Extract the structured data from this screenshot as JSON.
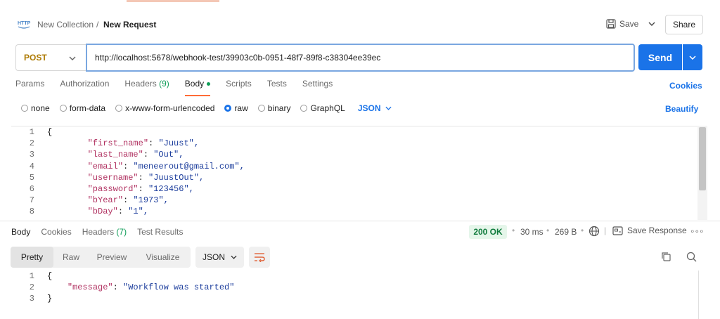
{
  "header": {
    "breadcrumb_parent": "New Collection",
    "breadcrumb_sep": "/",
    "breadcrumb_current": "New Request",
    "save_label": "Save",
    "share_label": "Share"
  },
  "request": {
    "method": "POST",
    "url": "http://localhost:5678/webhook-test/39903c0b-0951-48f7-89f8-c38304ee39ec",
    "send_label": "Send",
    "method_color": "#ad7a03"
  },
  "tabs": {
    "params": "Params",
    "authorization": "Authorization",
    "headers": "Headers",
    "headers_count": "(9)",
    "body": "Body",
    "scripts": "Scripts",
    "tests": "Tests",
    "settings": "Settings",
    "cookies": "Cookies"
  },
  "body_types": {
    "none": "none",
    "form_data": "form-data",
    "urlencoded": "x-www-form-urlencoded",
    "raw": "raw",
    "binary": "binary",
    "graphql": "GraphQL",
    "format": "JSON",
    "beautify": "Beautify"
  },
  "request_body": {
    "lines": [
      {
        "n": "1",
        "text": "{"
      },
      {
        "n": "2",
        "key": "\"first_name\"",
        "val": "\"Juust\","
      },
      {
        "n": "3",
        "key": "\"last_name\"",
        "val": "\"Out\","
      },
      {
        "n": "4",
        "key": "\"email\"",
        "val": "\"meneerout@gmail.com\","
      },
      {
        "n": "5",
        "key": "\"username\"",
        "val": "\"JuustOut\","
      },
      {
        "n": "6",
        "key": "\"password\"",
        "val": "\"123456\","
      },
      {
        "n": "7",
        "key": "\"bYear\"",
        "val": "\"1973\","
      },
      {
        "n": "8",
        "key": "\"bDay\"",
        "val": "\"1\","
      }
    ]
  },
  "response": {
    "tabs": {
      "body": "Body",
      "cookies": "Cookies",
      "headers": "Headers",
      "headers_count": "(7)",
      "test_results": "Test Results"
    },
    "status": "200 OK",
    "time": "30 ms",
    "size": "269 B",
    "save_response": "Save Response",
    "views": {
      "pretty": "Pretty",
      "raw": "Raw",
      "preview": "Preview",
      "visualize": "Visualize"
    },
    "format": "JSON",
    "body_lines": [
      {
        "n": "1",
        "text": "{"
      },
      {
        "n": "2",
        "key": "\"message\"",
        "val": "\"Workflow was started\""
      },
      {
        "n": "3",
        "text": "}"
      }
    ]
  },
  "colors": {
    "accent": "#1a73e8",
    "tab_underline": "#ff6c37",
    "status_green": "#0f7a3c"
  }
}
